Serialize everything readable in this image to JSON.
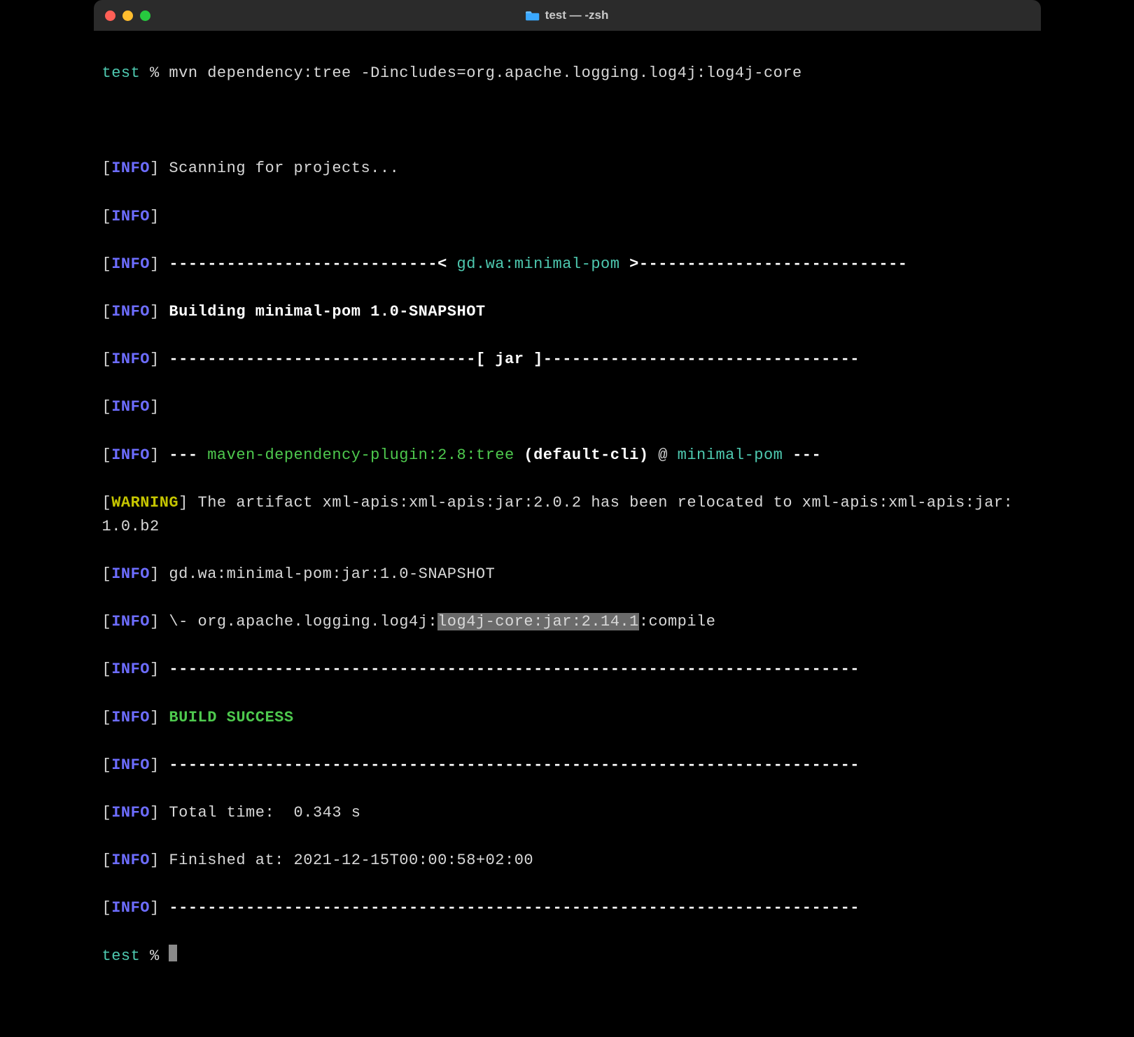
{
  "window": {
    "title": "test — -zsh"
  },
  "prompt": {
    "dir": "test",
    "symbol": "%"
  },
  "command": "mvn dependency:tree -Dincludes=org.apache.logging.log4j:log4j-core",
  "tags": {
    "info": "INFO",
    "warning": "WARNING"
  },
  "lines": {
    "scan": "Scanning for projects...",
    "hr1_left": "----------------------------< ",
    "hr1_mid": "gd.wa:minimal-pom",
    "hr1_right": " >----------------------------",
    "building": "Building minimal-pom 1.0-SNAPSHOT",
    "jar_rule": "--------------------------------[ jar ]---------------------------------",
    "plugin_dashes": "--- ",
    "plugin_green": "maven-dependency-plugin:2.8:tree",
    "plugin_bold": " (default-cli)",
    "plugin_at": " @ ",
    "plugin_cyan": "minimal-pom",
    "plugin_dashes2": " ---",
    "warn_text": "The artifact xml-apis:xml-apis:jar:2.0.2 has been relocated to xml-apis:xml-apis:jar:1.0.b2",
    "tree_root": "gd.wa:minimal-pom:jar:1.0-SNAPSHOT",
    "tree_child_pre": "\\- org.apache.logging.log4j:",
    "tree_child_hl": "log4j-core:jar:2.14.1",
    "tree_child_post": ":compile",
    "rule72": "------------------------------------------------------------------------",
    "build_success": "BUILD SUCCESS",
    "total_time": "Total time:  0.343 s",
    "finished": "Finished at: 2021-12-15T00:00:58+02:00"
  }
}
